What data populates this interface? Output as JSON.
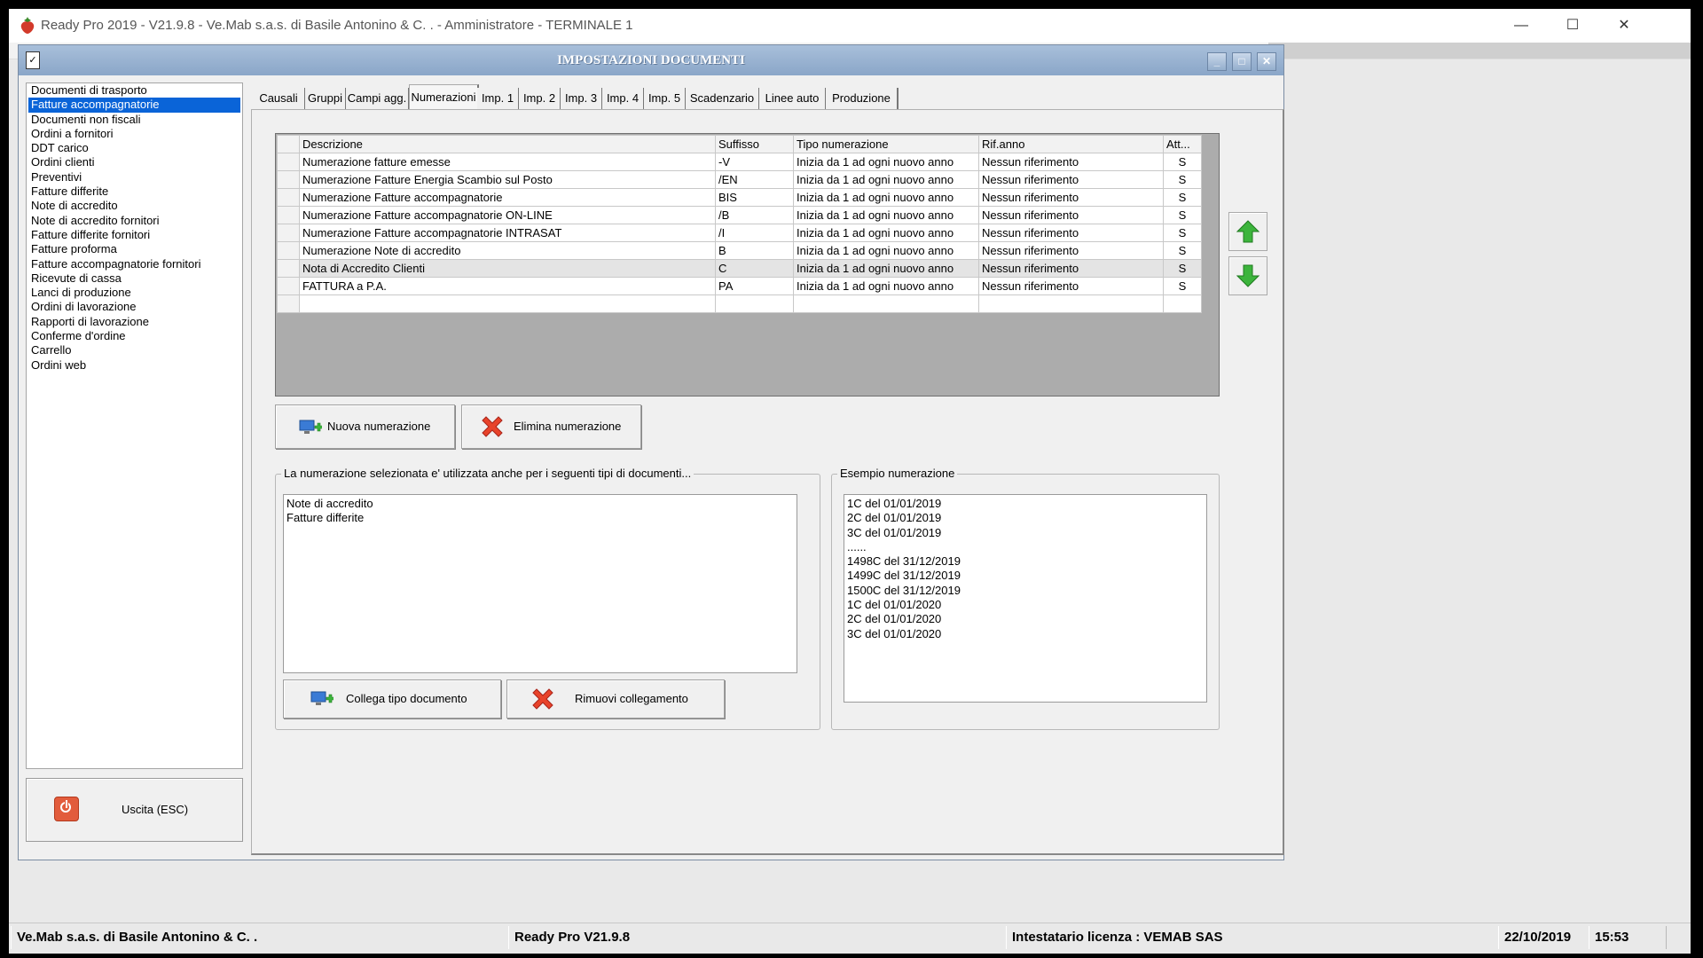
{
  "window": {
    "title": "Ready Pro 2019 - V21.9.8 - Ve.Mab s.a.s. di Basile Antonino & C. . - Amministratore - TERMINALE 1",
    "minimize_glyph": "—",
    "maximize_glyph": "☐",
    "close_glyph": "✕"
  },
  "dialog": {
    "title": "IMPOSTAZIONI DOCUMENTI",
    "minimize_glyph": "_",
    "maximize_glyph": "□",
    "close_glyph": "✕"
  },
  "document_types": [
    "Documenti di trasporto",
    "Fatture accompagnatorie",
    "Documenti non fiscali",
    "Ordini a fornitori",
    "DDT carico",
    "Ordini clienti",
    "Preventivi",
    "Fatture differite",
    "Note di accredito",
    "Note di accredito fornitori",
    "Fatture differite fornitori",
    "Fatture proforma",
    "Fatture accompagnatorie fornitori",
    "Ricevute di cassa",
    "Lanci di produzione",
    "Ordini di lavorazione",
    "Rapporti di lavorazione",
    "Conferme d'ordine",
    "Carrello",
    "Ordini web"
  ],
  "selected_document_type": "Fatture accompagnatorie",
  "exit_button": {
    "label": "Uscita (ESC)"
  },
  "tabs": [
    "Causali",
    "Gruppi",
    "Campi agg.",
    "Numerazioni",
    "Imp. 1",
    "Imp. 2",
    "Imp. 3",
    "Imp. 4",
    "Imp. 5",
    "Scadenzario",
    "Linee auto",
    "Produzione"
  ],
  "active_tab": "Numerazioni",
  "grid": {
    "columns": [
      "Descrizione",
      "Suffisso",
      "Tipo numerazione",
      "Rif.anno",
      "Att..."
    ],
    "rows": [
      [
        "Numerazione fatture emesse",
        "-V",
        "Inizia da 1 ad ogni nuovo anno",
        "Nessun riferimento",
        "S"
      ],
      [
        "Numerazione Fatture Energia Scambio sul Posto",
        "/EN",
        "Inizia da 1 ad ogni nuovo anno",
        "Nessun riferimento",
        "S"
      ],
      [
        "Numerazione Fatture accompagnatorie",
        "BIS",
        "Inizia da 1 ad ogni nuovo anno",
        "Nessun riferimento",
        "S"
      ],
      [
        "Numerazione Fatture accompagnatorie ON-LINE",
        "/B",
        "Inizia da 1 ad ogni nuovo anno",
        "Nessun riferimento",
        "S"
      ],
      [
        "Numerazione Fatture accompagnatorie INTRASAT",
        "/I",
        "Inizia da 1 ad ogni nuovo anno",
        "Nessun riferimento",
        "S"
      ],
      [
        "Numerazione Note di accredito",
        "B",
        "Inizia da 1 ad ogni nuovo anno",
        "Nessun riferimento",
        "S"
      ],
      [
        "Nota di Accredito Clienti",
        "C",
        "Inizia da 1 ad ogni nuovo anno",
        "Nessun riferimento",
        "S"
      ],
      [
        "FATTURA a P.A.",
        "PA",
        "Inizia da 1 ad ogni nuovo anno",
        "Nessun riferimento",
        "S"
      ]
    ],
    "highlighted_row": "Nota di Accredito Clienti"
  },
  "buttons": {
    "new_numbering": "Nuova numerazione",
    "delete_numbering": "Elimina numerazione",
    "link_doc_type": "Collega tipo documento",
    "remove_link": "Rimuovi collegamento"
  },
  "linked_group": {
    "legend": "La numerazione selezionata e' utilizzata anche per i seguenti tipi di documenti...",
    "items": [
      "Note di accredito",
      "Fatture differite"
    ]
  },
  "example_group": {
    "legend": "Esempio numerazione",
    "lines": [
      "1C del 01/01/2019",
      "2C del 01/01/2019",
      "3C del 01/01/2019",
      "......",
      "1498C del 31/12/2019",
      "1499C del 31/12/2019",
      "1500C del 31/12/2019",
      "1C del 01/01/2020",
      "2C del 01/01/2020",
      "3C del 01/01/2020"
    ]
  },
  "statusbar": {
    "company": "Ve.Mab s.a.s. di Basile Antonino & C. .",
    "version": "Ready Pro V21.9.8",
    "license": "Intestatario licenza : VEMAB SAS",
    "date": "22/10/2019",
    "time": "15:53"
  },
  "colors": {
    "selection": "#0a64d8",
    "dialog_title": "#8aa6c8",
    "arrow_green": "#3cb43c",
    "delete_red": "#e8432a"
  }
}
